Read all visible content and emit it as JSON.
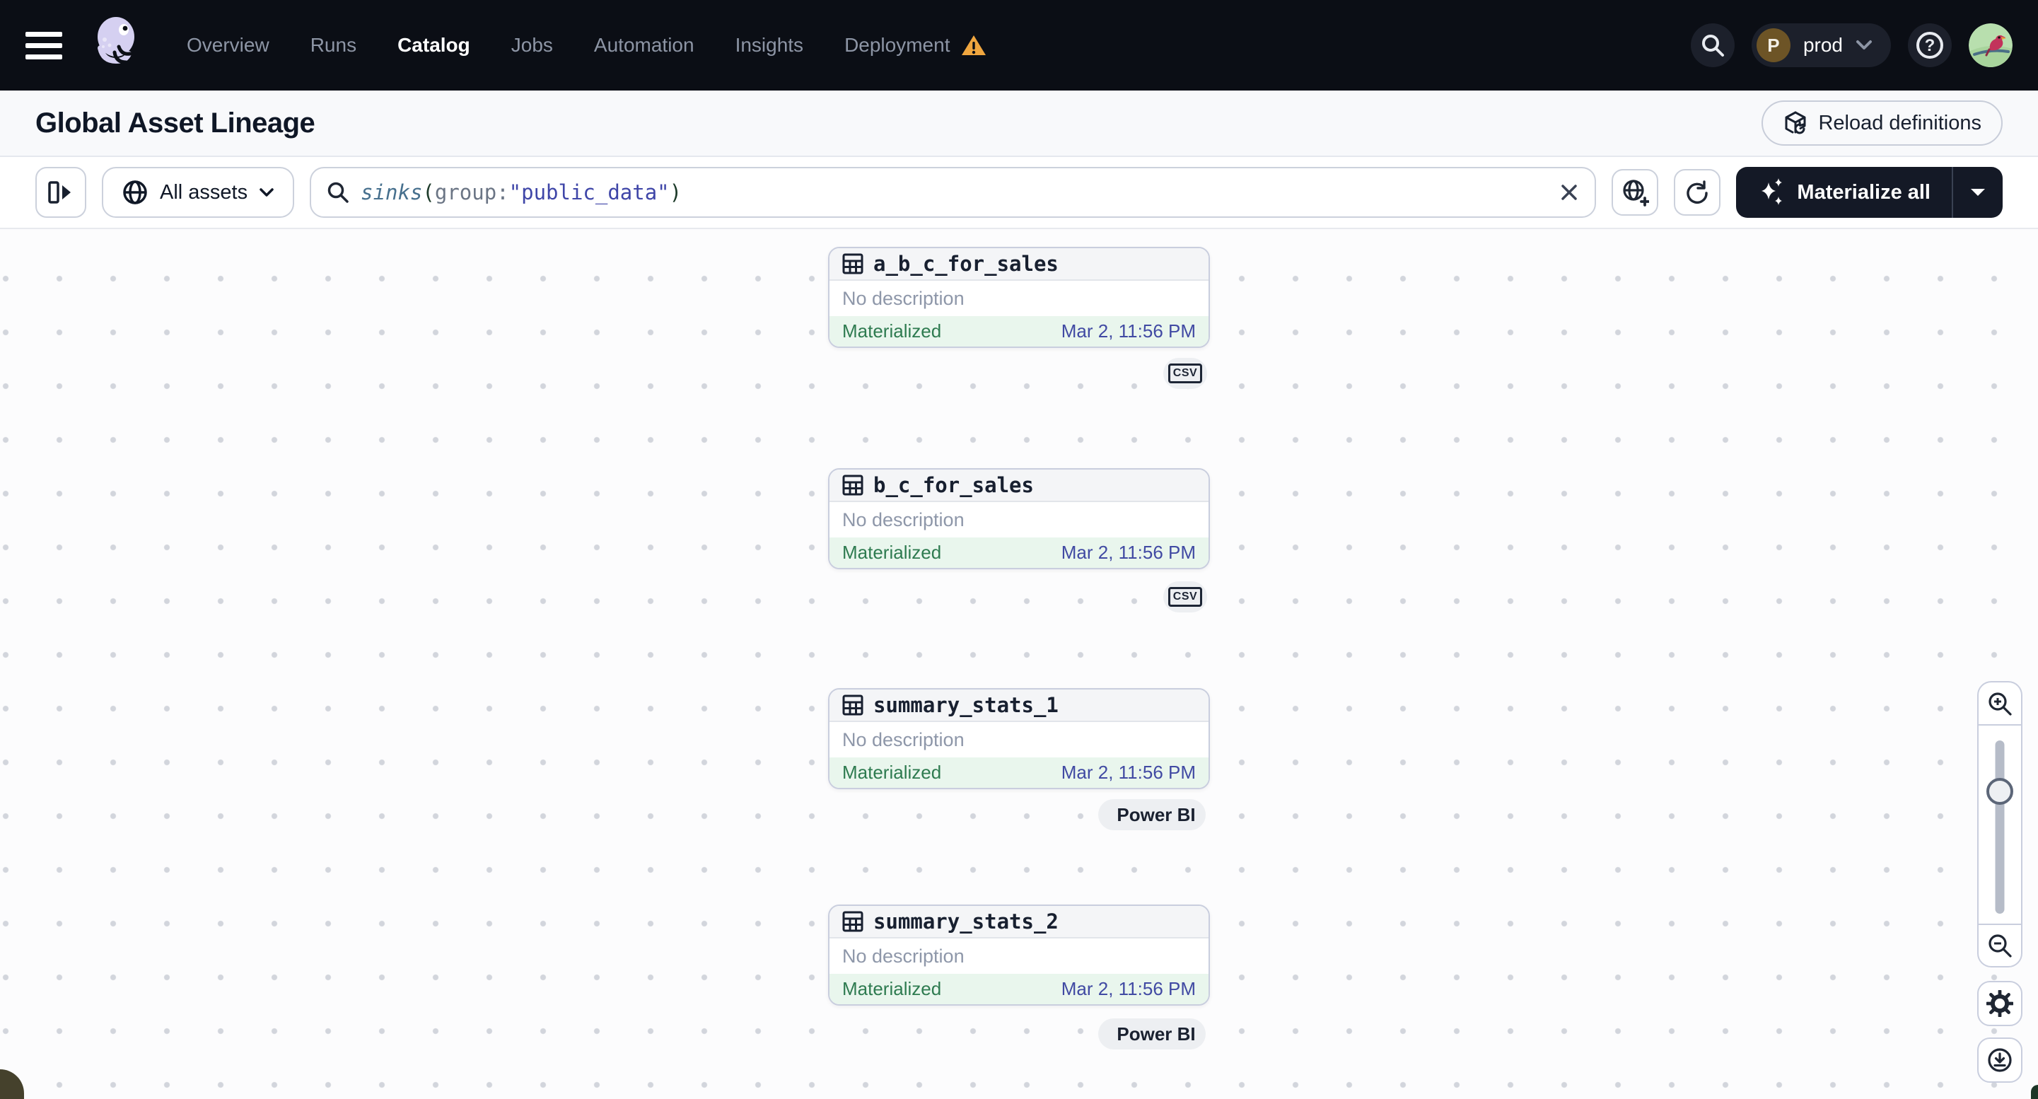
{
  "colors": {
    "topbar_bg": "#0b0e15",
    "brand_lavender": "#d5d0f1",
    "warning_orange": "#f0a63f",
    "materialized_green": "#2e7b50",
    "timestamp_indigo": "#414aa3",
    "dark_button": "#141926",
    "powerbi_gold": "#d9a62a"
  },
  "topnav": {
    "items": [
      {
        "label": "Overview"
      },
      {
        "label": "Runs"
      },
      {
        "label": "Catalog"
      },
      {
        "label": "Jobs"
      },
      {
        "label": "Automation"
      },
      {
        "label": "Insights"
      },
      {
        "label": "Deployment"
      }
    ],
    "active_item": "Catalog",
    "environment": {
      "initial": "P",
      "name": "prod"
    },
    "help_glyph": "?"
  },
  "header": {
    "title": "Global Asset Lineage",
    "reload_label": "Reload definitions"
  },
  "toolbar": {
    "scope_label": "All assets",
    "search": {
      "parts": [
        {
          "text": "sinks"
        },
        {
          "text": "("
        },
        {
          "text": "group:"
        },
        {
          "text": "\"public_data\""
        },
        {
          "text": ")"
        }
      ]
    },
    "materialize_label": "Materialize all"
  },
  "graph": {
    "nodes": [
      {
        "name": "a_b_c_for_sales",
        "description": "No description",
        "status": "Materialized",
        "timestamp": "Mar 2, 11:56 PM",
        "integration": "CSV"
      },
      {
        "name": "b_c_for_sales",
        "description": "No description",
        "status": "Materialized",
        "timestamp": "Mar 2, 11:56 PM",
        "integration": "CSV"
      },
      {
        "name": "summary_stats_1",
        "description": "No description",
        "status": "Materialized",
        "timestamp": "Mar 2, 11:56 PM",
        "integration": "Power BI"
      },
      {
        "name": "summary_stats_2",
        "description": "No description",
        "status": "Materialized",
        "timestamp": "Mar 2, 11:56 PM",
        "integration": "Power BI"
      }
    ],
    "tags": {
      "csv_label": "CSV",
      "powerbi_label": "Power BI"
    }
  }
}
